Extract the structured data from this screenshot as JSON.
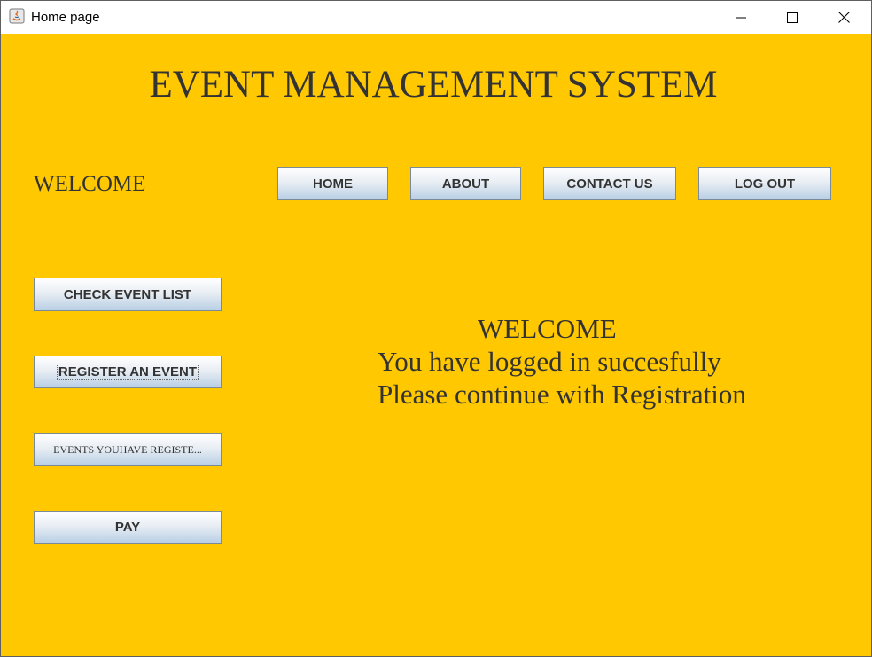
{
  "window": {
    "title": "Home page",
    "controls": {
      "minimize": "minimize-icon",
      "maximize": "maximize-icon",
      "close": "close-icon"
    }
  },
  "colors": {
    "background": "#ffc800",
    "text": "#333333",
    "button_top": "#ffffff",
    "button_bottom": "#b8cfe5"
  },
  "main": {
    "heading": "EVENT MANAGEMENT SYSTEM",
    "welcome_label": "WELCOME",
    "nav": {
      "home": "HOME",
      "about": "ABOUT",
      "contact": "CONTACT US",
      "logout": "LOG OUT"
    },
    "side": {
      "check_events": "CHECK EVENT LIST",
      "register_event": "REGISTER AN EVENT",
      "registered_events": "EVENTS YOUHAVE REGISTE...",
      "pay": "PAY"
    },
    "message": {
      "line1": "WELCOME",
      "line2": "You have logged in succesfully",
      "line3": "Please continue with Registration"
    }
  }
}
